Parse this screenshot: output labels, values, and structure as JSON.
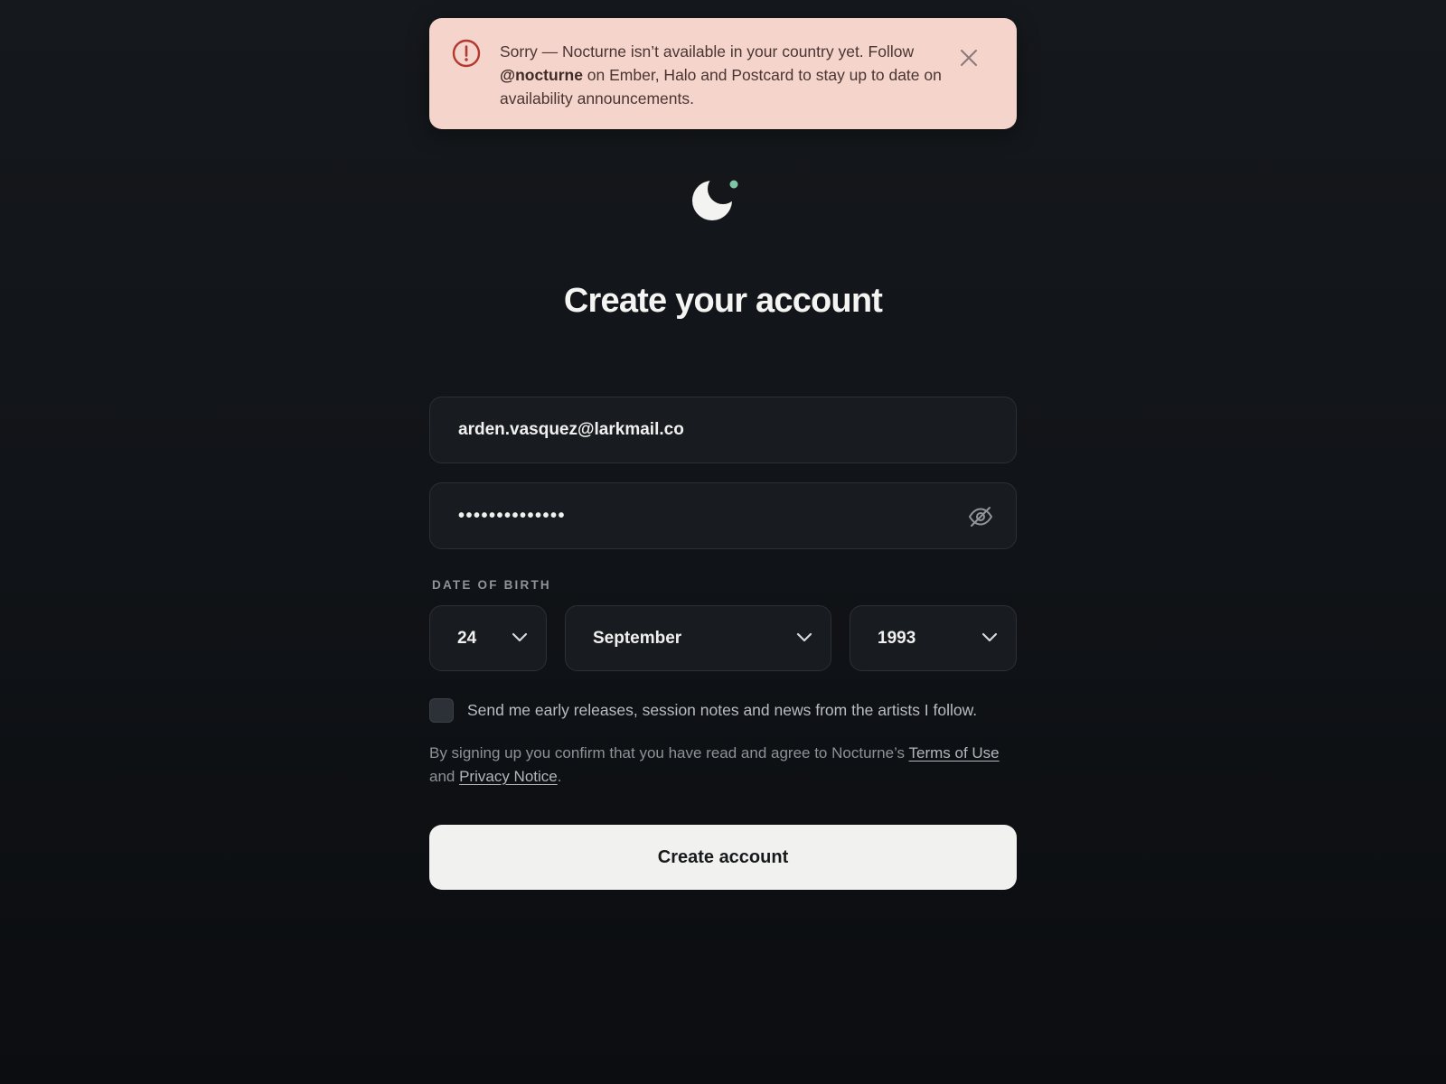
{
  "alert": {
    "icon": "alert-circle-icon",
    "text_before": "Sorry — Nocturne isn’t available in your country yet. Follow ",
    "handle": "@nocturne",
    "text_after": " on Ember, Halo and Postcard to stay up to date on availability announcements.",
    "close_icon": "close-icon",
    "background_color": "#f4d4cb",
    "accent_color": "#b2392e"
  },
  "logo": {
    "icon": "crescent-moon-icon",
    "dot_color": "#7fc6a4"
  },
  "heading": "Create your account",
  "form": {
    "email": {
      "value": "arden.vasquez@larkmail.co"
    },
    "password": {
      "masked_value": "••••••••••••••",
      "toggle_icon": "eye-off-icon"
    },
    "dob": {
      "label": "DATE OF BIRTH",
      "day": "24",
      "month": "September",
      "year": "1993"
    },
    "newsletter": {
      "checked": false,
      "label": "Send me early releases, session notes and news from the artists I follow."
    },
    "legal": {
      "text_before": "By signing up you confirm that you have read and agree to Nocturne’s ",
      "terms_link": "Terms of Use",
      "text_middle": " and ",
      "privacy_link": "Privacy Notice",
      "text_after": "."
    },
    "submit_label": "Create account"
  }
}
